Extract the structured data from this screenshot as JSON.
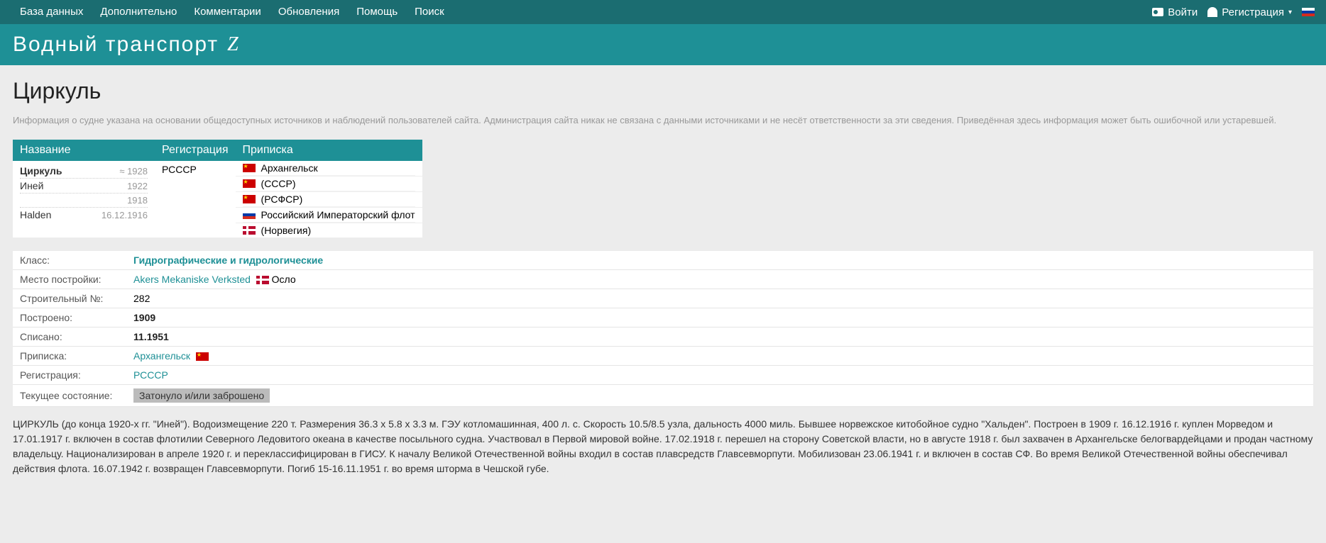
{
  "nav": {
    "items": [
      "База данных",
      "Дополнительно",
      "Комментарии",
      "Обновления",
      "Помощь",
      "Поиск"
    ],
    "login": "Войти",
    "register": "Регистрация"
  },
  "banner": {
    "title": "Водный транспорт"
  },
  "page": {
    "title": "Циркуль",
    "disclaimer": "Информация о судне указана на основании общедоступных источников и наблюдений пользователей сайта. Администрация сайта никак не связана с данными источниками и не несёт ответственности за эти сведения. Приведённая здесь информация может быть ошибочной или устаревшей."
  },
  "summary": {
    "headers": {
      "name": "Название",
      "reg": "Регистрация",
      "port": "Приписка"
    },
    "names": [
      {
        "label": "Циркуль",
        "bold": true,
        "date": "≈ 1928"
      },
      {
        "label": "Иней",
        "bold": false,
        "date": "1922"
      },
      {
        "label": "",
        "bold": false,
        "date": "1918"
      },
      {
        "label": "Halden",
        "bold": false,
        "date": "16.12.1916"
      }
    ],
    "reg": "РСССР",
    "ports": [
      {
        "flag": "ussr",
        "label": "Архангельск"
      },
      {
        "flag": "ussr",
        "label": "(СССР)"
      },
      {
        "flag": "ussr",
        "label": "(РСФСР)"
      },
      {
        "flag": "imp",
        "label": "Российский Императорский флот"
      },
      {
        "flag": "no",
        "label": "(Норвегия)"
      }
    ]
  },
  "details": {
    "class_label": "Класс:",
    "class_value": "Гидрографические и гидрологические",
    "build_place_label": "Место постройки:",
    "build_place_value": "Akers Mekaniske Verksted",
    "build_place_city": "Осло",
    "build_no_label": "Строительный №:",
    "build_no_value": "282",
    "built_label": "Построено:",
    "built_value": "1909",
    "scrapped_label": "Списано:",
    "scrapped_value": "11.1951",
    "port_label": "Приписка:",
    "port_value": "Архангельск",
    "reg_label": "Регистрация:",
    "reg_value": "РСССР",
    "status_label": "Текущее состояние:",
    "status_value": "Затонуло и/или заброшено"
  },
  "description": "ЦИРКУЛЬ (до конца 1920-х гг. \"Иней\"). Водоизмещение 220 т. Размерения 36.3 х 5.8 х 3.3 м. ГЭУ котломашинная, 400 л. с. Скорость 10.5/8.5 узла, дальность 4000 миль. Бывшее норвежское китобойное судно \"Хальден\". Построен в 1909 г. 16.12.1916 г. куплен Морведом и 17.01.1917 г. включен в состав флотилии Северного Ледовитого океана в качестве посыльного судна. Участвовал в Первой мировой войне. 17.02.1918 г. перешел на сторону Советской власти, но в августе 1918 г. был захвачен в Архангельске белогвардейцами и продан частному владельцу. Национализирован в апреле 1920 г. и переклассифицирован в ГИСУ. К началу Великой Отечественной войны входил в состав плавсредств Главсевморпути. Мобилизован 23.06.1941 г. и включен в состав СФ. Во время Великой Отечественной войны обеспечивал действия флота. 16.07.1942 г. возвращен Главсевморпути. Погиб 15-16.11.1951 г. во время шторма в Чешской губе."
}
